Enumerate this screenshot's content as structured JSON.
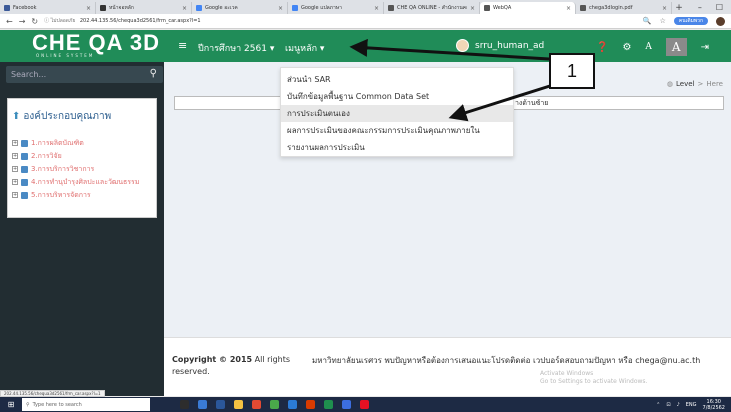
{
  "browser": {
    "tabs": [
      {
        "label": "Facebook",
        "color": "#3b5998"
      },
      {
        "label": "หน้าจอหลัก",
        "color": "#333333"
      },
      {
        "label": "Google อะเวค",
        "color": "#4285f4"
      },
      {
        "label": "Google แปลภาษา",
        "color": "#4285f4"
      },
      {
        "label": "CHE QA ONLINE - สำนักงานคณะฯ",
        "color": "#555555"
      },
      {
        "label": "WebQA",
        "color": "#555555",
        "active": true
      },
      {
        "label": "chega3dlogin.pdf",
        "color": "#555555"
      }
    ],
    "new_tab": "+",
    "window_controls": [
      "–",
      "☐"
    ],
    "address": {
      "security": "ไม่ปลอดภัย",
      "url": "202.44.135.56/chequa3d2561/frm_car.aspx?l=1"
    },
    "account_label": "คนเดิมพวก"
  },
  "header": {
    "logo_main": "CHE QA",
    "logo_3d": "3D",
    "logo_sub": "ONLINE SYSTEM",
    "menu_icon": "hamburger-icon",
    "year": "ปีการศึกษา 2561 ▾",
    "main_menu": "เมนูหลัก ▾",
    "user": "srru_human_ad",
    "icons": [
      "question-icon",
      "cogs-icon"
    ],
    "font_small": "A",
    "font_large": "A",
    "logout_icon": "sign-out-icon",
    "bg_color": "#208c58"
  },
  "sidebar": {
    "search_placeholder": "Search...",
    "panel_title": "องค์ประกอบคุณภาพ",
    "items": [
      {
        "label": "1.การผลิตบัณฑิต"
      },
      {
        "label": "2.การวิจัย"
      },
      {
        "label": "3.การบริการวิชาการ"
      },
      {
        "label": "4.การทำนุบำรุงศิลปะและวัฒนธรรม"
      },
      {
        "label": "5.การบริหารจัดการ"
      }
    ]
  },
  "dropdown": {
    "items": [
      {
        "label": "ส่วนนำ SAR"
      },
      {
        "label": "บันทึกข้อมูลพื้นฐาน Common Data Set"
      },
      {
        "label": "การประเมินตนเอง",
        "highlighted": true
      },
      {
        "label": "ผลการประเมินของคณะกรรมการประเมินคุณภาพภายใน"
      },
      {
        "label": "รายงานผลการประเมิน"
      }
    ]
  },
  "breadcrumb": {
    "level": "Level",
    "sep": ">",
    "here": "Here"
  },
  "content": {
    "caption": "างด้านซ้าย"
  },
  "footer": {
    "copyright_bold": "Copyright © 2015",
    "copyright_rest": " All rights",
    "reserved": "reserved.",
    "contact": "มหาวิทยาลัยนเรศวร พบปัญหาหรือต้องการเสนอแนะโปรดติดต่อ เวปบอร์ดสอบถามปัญหา หรือ chega@nu.ac.th",
    "watermark_line1": "Activate Windows",
    "watermark_line2": "Go to Settings to activate Windows."
  },
  "annotation": {
    "label": "1"
  },
  "status_link": "202.44.135.56/chequa3d2561/frm_car.aspx?l=1",
  "taskbar": {
    "search_placeholder": "Type here to search",
    "tray_lang": "ENG",
    "time": "16:30",
    "date": "7/8/2562"
  }
}
